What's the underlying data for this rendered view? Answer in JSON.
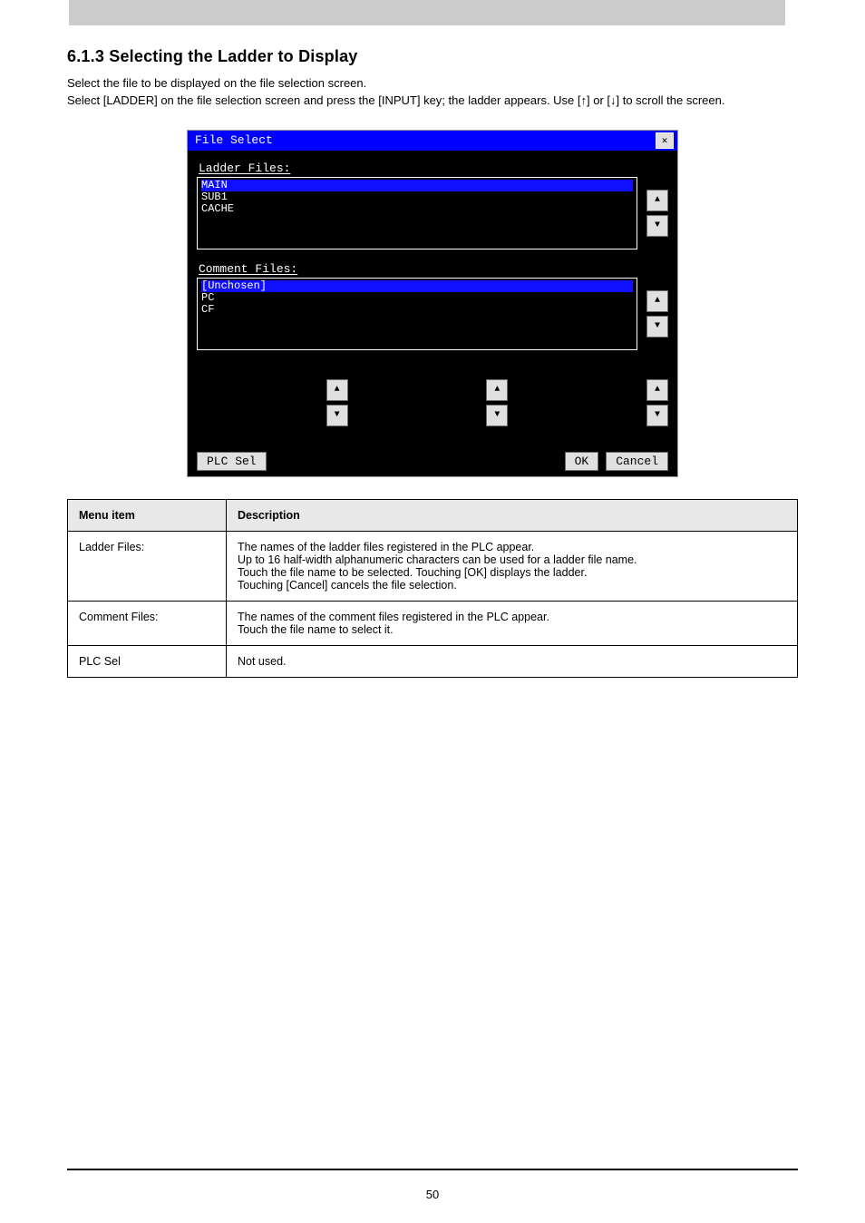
{
  "section": {
    "heading": "6.1.3 Selecting the Ladder to Display",
    "intro": "Select the file to be displayed on the file selection screen.\nSelect [LADDER] on the file selection screen and press the [INPUT] key; the ladder appears. Use [↑] or [↓] to scroll the screen."
  },
  "dialog": {
    "title": "File Select",
    "close_glyph": "✕",
    "ladder_label": "Ladder Files:",
    "ladder_items": [
      "MAIN",
      "SUB1",
      "CACHE"
    ],
    "ladder_selected": 0,
    "comment_label": "Comment Files:",
    "comment_items": [
      "[Unchosen]",
      "PC",
      "CF"
    ],
    "comment_selected": 0,
    "arrow_up": "▲",
    "arrow_down": "▼",
    "plc_sel": "PLC Sel",
    "ok": "OK",
    "cancel": "Cancel"
  },
  "table": {
    "head_item": "Menu item",
    "head_desc": "Description",
    "rows": [
      {
        "name": "Ladder Files:",
        "desc": "The names of the ladder files registered in the PLC appear.\nUp to 16 half-width alphanumeric characters can be used for a ladder file name.\nTouch the file name to be selected. Touching [OK] displays the ladder.\nTouching [Cancel] cancels the file selection."
      },
      {
        "name": "Comment Files:",
        "desc": "The names of the comment files registered in the PLC appear.\nTouch the file name to select it."
      },
      {
        "name": "PLC Sel",
        "desc": "Not used."
      }
    ]
  },
  "page_number": "50"
}
